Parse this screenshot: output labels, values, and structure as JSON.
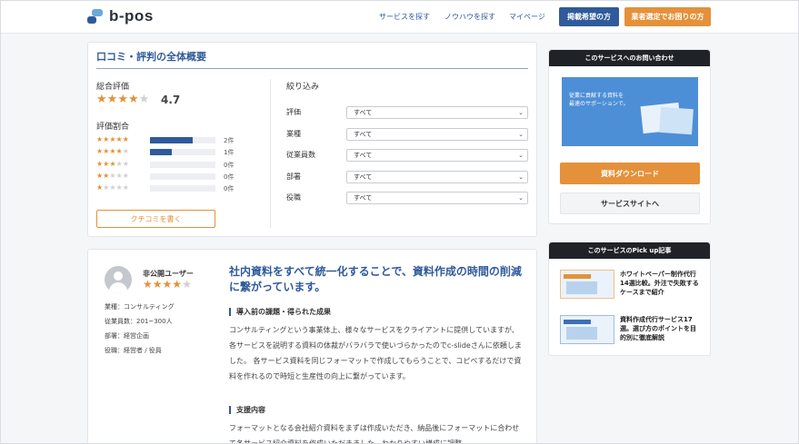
{
  "header": {
    "logo": "b-pos",
    "nav": [
      "サービスを探す",
      "ノウハウを探す",
      "マイページ"
    ],
    "btn_listing": "掲載希望の方",
    "btn_vendor": "業者選定でお困りの方"
  },
  "summary": {
    "title": "口コミ・評判の全体概要",
    "overall_label": "総合評価",
    "overall_score": "4.7",
    "overall_stars": 4,
    "ratio_label": "評価割合",
    "distribution": [
      {
        "stars": 5,
        "fraction": 0.65,
        "count": "2件"
      },
      {
        "stars": 4,
        "fraction": 0.33,
        "count": "1件"
      },
      {
        "stars": 3,
        "fraction": 0,
        "count": "0件"
      },
      {
        "stars": 2,
        "fraction": 0,
        "count": "0件"
      },
      {
        "stars": 1,
        "fraction": 0,
        "count": "0件"
      }
    ],
    "write_button": "クチコミを書く",
    "filter_title": "絞り込み",
    "filters": [
      {
        "label": "評価",
        "value": "すべて"
      },
      {
        "label": "業種",
        "value": "すべて"
      },
      {
        "label": "従業員数",
        "value": "すべて"
      },
      {
        "label": "部署",
        "value": "すべて"
      },
      {
        "label": "役職",
        "value": "すべて"
      }
    ]
  },
  "review": {
    "user": "非公開ユーザー",
    "stars": 4,
    "meta": [
      "業種：コンサルティング",
      "従業員数：201~300人",
      "部署：経営企画",
      "役職：経営者 / 役員"
    ],
    "title": "社内資料をすべて統一化することで、資料作成の時間の削減に繋がっています。",
    "sec1_title": "導入前の課題・得られた成果",
    "sec1_body": "コンサルティングという事業体上、様々なサービスをクライアントに提供していますが、各サービスを説明する資料の体裁がバラバラで使いづらかったのでc-slideさんに依頼しました。 各サービス資料を同じフォーマットで作成してもらうことで、コピペするだけで資料を作れるので時短と生産性の向上に繋がっています。",
    "sec2_title": "支援内容",
    "sec2_body": "フォーマットとなる会社紹介資料をまずは作成いただき、納品後にフォーマットに合わせて各サービス紹介資料を作成いただきました。わかりやすい構成に調整"
  },
  "sidebar": {
    "contact_title": "このサービスへのお問い合わせ",
    "promo_text": [
      "従業に貢献する資料を",
      "最速のサポーションで。"
    ],
    "download_button": "資料ダウンロード",
    "site_button": "サービスサイトへ",
    "pickup_title": "このサービスのPick up記事",
    "articles": [
      "ホワイトペーパー制作代行14選比較。外注で失敗するケースまで紹介",
      "資料作成代行サービス17選。選び方のポイントを目的別に徹底解説"
    ]
  },
  "colors": {
    "brand": "#2f5a9b",
    "accent": "#e4913a",
    "dark": "#1f2328"
  }
}
